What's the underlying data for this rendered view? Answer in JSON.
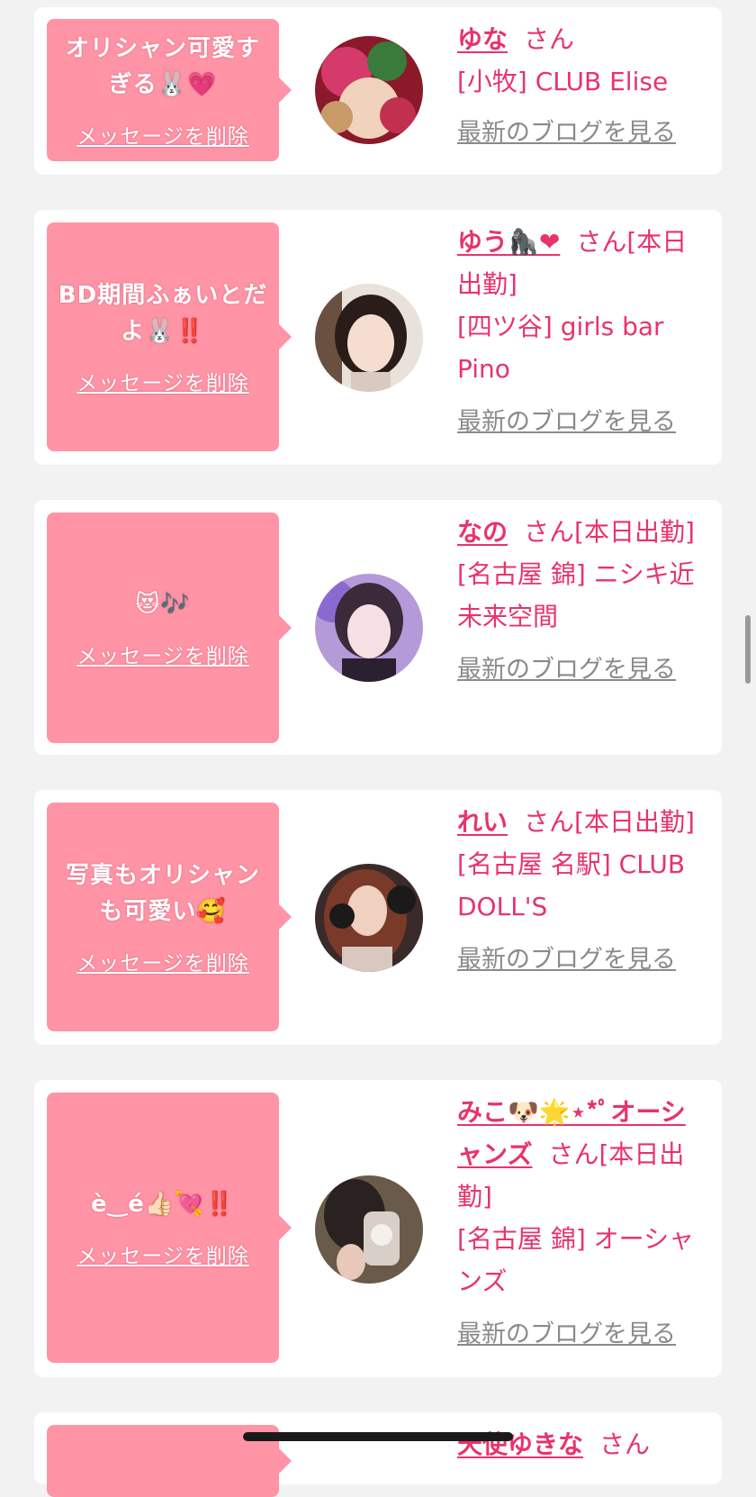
{
  "cards": [
    {
      "message": "オリシャン可愛すぎる🐰💗",
      "delete_label": "メッセージを削除",
      "name": "ゆな",
      "san": "さん",
      "store": "[小牧] CLUB Elise",
      "blog_label": "最新のブログを見る"
    },
    {
      "message": "BD期間ふぁいとだよ🐰‼️",
      "delete_label": "メッセージを削除",
      "name": "ゆう🦍❤",
      "san": "さん[本日出勤]",
      "store": "[四ツ谷] girls bar Pino",
      "blog_label": "最新のブログを見る"
    },
    {
      "message": "😻🎶",
      "delete_label": "メッセージを削除",
      "name": "なの",
      "san": "さん[本日出勤]",
      "store": "[名古屋 錦] ニシキ近未来空間",
      "blog_label": "最新のブログを見る"
    },
    {
      "message": "写真もオリシャンも可愛い🥰",
      "delete_label": "メッセージを削除",
      "name": "れい",
      "san": "さん[本日出勤]",
      "store": "[名古屋 名駅] CLUB DOLL'S",
      "blog_label": "最新のブログを見る"
    },
    {
      "message": "è‿é👍🏻💘‼️",
      "delete_label": "メッセージを削除",
      "name": "みこ🐶🌟⋆*ﾟオーシャンズ",
      "san": "さん[本日出勤]",
      "store": "[名古屋 錦] オーシャンズ",
      "blog_label": "最新のブログを見る"
    },
    {
      "name": "天使ゆきな",
      "san": "さん"
    }
  ],
  "colors": {
    "accent": "#e8336b",
    "message_bg": "#ff94a6",
    "page_bg": "#f2f2f2",
    "link_gray": "#8a8a8a"
  }
}
